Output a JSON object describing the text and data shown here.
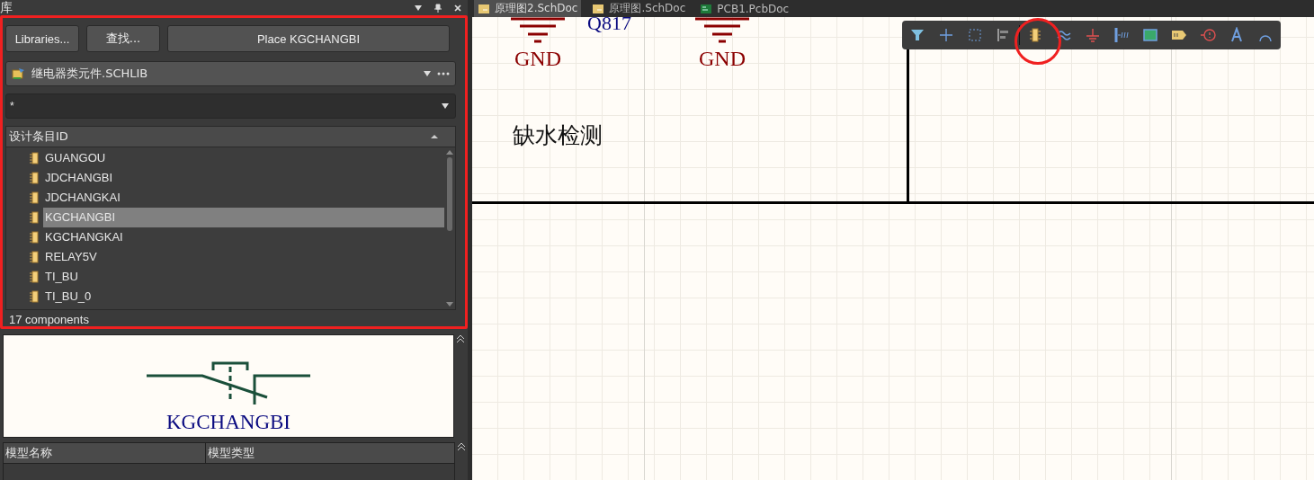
{
  "library_panel": {
    "title": "库",
    "buttons": [
      "Libraries...",
      "查找...",
      "Place KGCHANGBI"
    ],
    "library_select": {
      "value": "继电器类元件.SCHLIB"
    },
    "filter": {
      "value": "*"
    },
    "components": {
      "column": "设计条目ID",
      "items": [
        {
          "name": "GUANGOU",
          "selected": false
        },
        {
          "name": "JDCHANGBI",
          "selected": false
        },
        {
          "name": "JDCHANGKAI",
          "selected": false
        },
        {
          "name": "KGCHANGBI",
          "selected": true
        },
        {
          "name": "KGCHANGKAI",
          "selected": false
        },
        {
          "name": "RELAY5V",
          "selected": false
        },
        {
          "name": "TI_BU",
          "selected": false
        },
        {
          "name": "TI_BU_0",
          "selected": false
        }
      ],
      "count": "17 components"
    },
    "preview": {
      "label": "KGCHANGBI"
    },
    "models": {
      "columns": [
        "模型名称",
        "模型类型"
      ]
    }
  },
  "document_tabs": [
    {
      "label": "原理图2.SchDoc",
      "kind": "sch",
      "selected": true
    },
    {
      "label": "原理图.SchDoc",
      "kind": "sch",
      "selected": false
    },
    {
      "label": "PCB1.PcbDoc",
      "kind": "pcb",
      "selected": false
    }
  ],
  "schematic": {
    "labels": [
      {
        "kind": "designator",
        "text": "Q817"
      },
      {
        "kind": "power",
        "text": "GND"
      },
      {
        "kind": "power",
        "text": "GND"
      },
      {
        "kind": "note",
        "text": "缺水检测"
      }
    ]
  }
}
